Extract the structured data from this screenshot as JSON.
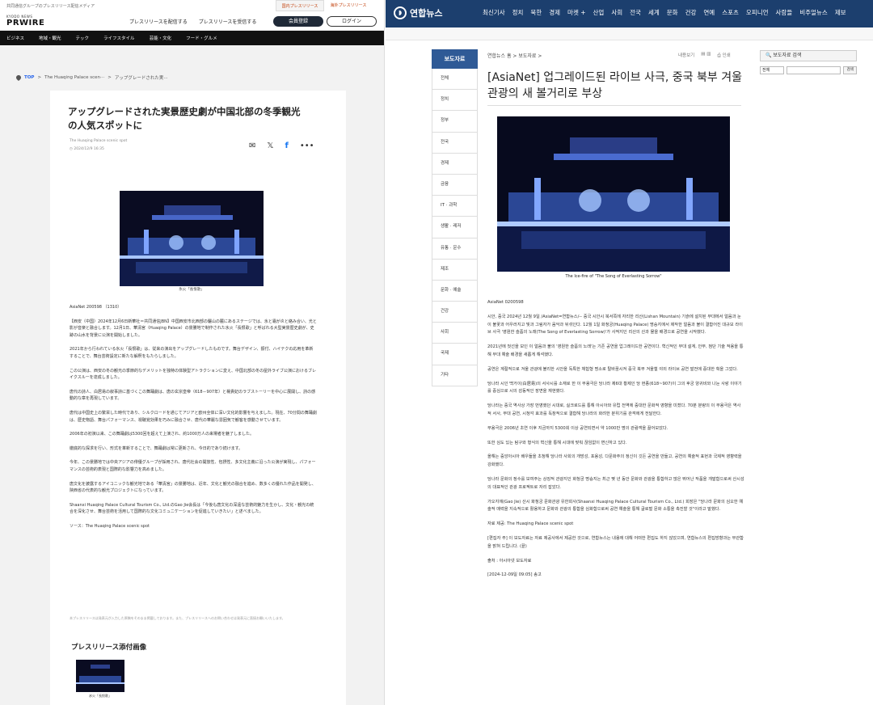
{
  "left": {
    "top_tagline": "共同通信グループのプレスリリース配信メディア",
    "tabs": [
      "国内プレスリリース",
      "海外プレスリリース"
    ],
    "logo_small": "KYODO NEWS",
    "logo_big": "PRWIRE",
    "header_links": [
      "プレスリリースを配信する",
      "プレスリリースを受信する"
    ],
    "register_btn": "会員登録",
    "login_btn": "ログイン",
    "nav": [
      "ビジネス",
      "地域・観光",
      "テック",
      "ライフスタイル",
      "芸能・文化",
      "フード・グルメ"
    ],
    "breadcrumb": {
      "home": "TOP",
      "sep1": ">",
      "mid": "The Huaqing Palace scen···",
      "sep2": ">",
      "cur": "アップグレードされた実···"
    },
    "title": "アップグレードされた実景歴史劇が中国北部の冬季観光の人気スポットに",
    "source": "The Huaqing Palace scenic spot",
    "date": "2024/12/9 16:35",
    "share": {
      "mail": "✉",
      "x": "𝕏",
      "fb": "f",
      "more": "•••"
    },
    "image_caption": "氷火「長恨歌」",
    "paragraphs": [
      "AsiaNet 200598 （1310）",
      "【西安（中国）2024年12月6日新華社＝共同通信JBN】中国西安市北西部の驪山の麓にあるステージでは、氷と霜が炎と絡み合い、光と影が音楽と融合します。12月1日、華清宮（Huaqing Palace）の景勝地で制作された氷火「長恨歌」と呼ばれる大型実景歴史劇が、史跡の山水を背景に公演を開始しました。",
      "2021年から行われている氷火「長恨歌」は、従来の演出をアップグレードしたものです。舞台デザイン、振付、ハイテクの応用を革新することで、舞台芸術設定に新たな解釈をもたらしました。",
      "この公演は、西安の冬の観光の季節的なデメリットを独特の体験型アトラクションに変え、中国北部の冬の屋外ライブ公演におけるブレイクスルーを達成しました。",
      "唐代の詩人、白居易の叙事詩に基づくこの舞踊劇は、唐の玄宗皇帝（618－907年）と楊貴妃のラブストーリーを中心に展開し、詩の感動的な章を再現しています。",
      "唐代は中国史上の繁栄した時代であり、シルクロードを通じてアジアと欧州全体に深い文化的影響を与えました。現在、70分間の舞踊劇は、歴史物語、舞台パフォーマンス、視聴覚効果を巧みに融合させ、唐代の華麗な雰囲気で観客を感動させています。",
      "2006年の初演以来、この舞踊劇は5300回を超えて上演され、約1000万人の来場者を魅了しました。",
      "徹底的な探求を行い、形式を革新することで、舞踊劇は常に更新され、今日的であり続けます。",
      "今年、この景勝地では中央アジアの俳優グループが採用され、唐代社会の開放性、包摂性、多文化主義に沿った公演が実現し、パフォーマンスの芸術的表現と国際的な影響力を高めました。",
      "唐文化を披露するアイコニックな観光地である「華清宮」の景勝地は、近年、文化と観光の融合を進め、数多くの優れた作品を開発し、陝西省の代表的な観光プロジェクトになっています。",
      "Shaanxi Huaqing Palace Cultural Tourism Co., Ltd.のGao Jie会長は「今後も唐文化の深遠な芸術的魅力を生かし、文化・観光の統合を深化させ、舞台芸術を活用して国際的な文化コミュニケーションを促進していきたい」と述べました。",
      "ソース：The Huaqing Palace scenic spot"
    ],
    "note": "本プレスリリースは発表元が入力した原稿をそのまま掲載しております。また、プレスリリースへのお問い合わせは発表元に直接お願いいたします。",
    "attach_heading": "プレスリリース添付画像",
    "thumb_caption": "氷火「長恨歌」"
  },
  "right": {
    "logo": "연합뉴스",
    "nav": [
      "최신기사",
      "정치",
      "북한",
      "경제",
      "마켓 +",
      "산업",
      "사회",
      "전국",
      "세계",
      "문화",
      "건강",
      "연예",
      "스포츠",
      "오피니언",
      "사람들",
      "비주얼뉴스",
      "제보"
    ],
    "sidebar_title": "보도자료",
    "sidebar": [
      "전체",
      "정치",
      "정부",
      "전국",
      "경제",
      "금융",
      "IT · 과학",
      "생활 · 레저",
      "유통 · 운수",
      "제조",
      "문화 · 예술",
      "건강",
      "사회",
      "국제",
      "기타"
    ],
    "breadcrumb": "연합뉴스 홈 > 보도자료 >",
    "tools": {
      "listen": "내용보기",
      "print": "인쇄"
    },
    "title": "[AsiaNet] 업그레이드된 라이브 사극, 중국 북부 겨울 관광의 새 볼거리로 부상",
    "image_caption": "The Ice-fire of \"The Song of Everlasting Sorrow\"",
    "paragraphs": [
      "AsiaNet 0200598",
      "시안, 중국 2024년 12월 9일 /AsiaNet=연합뉴스/-- 중국 시안시 북서쪽에 자리한 리산(Lishan Mountain) 기슭에 설치된 무대에서 얼음과 눈이 불꽃과 어우러지고 빛과 그림자가 음악과 뒤섞인다. 12월 1일 화청궁(Huaqing Palace) 명승지에서 제작한 얼음과 불이 결합어진 대규모 라이브 사극 '영원한 슬픔의 노래(The Song of Everlasting Sorrow)'가 사적지인 리산의 산과 물을 배경으로 공연을 시작했다.",
      "2021년에 첫선을 보인 이 얼음과 불의 '영원한 슬픔의 노래'는 기존 공연을 업그레이드한 공연이다. 혁신적인 무대 설계, 안무, 첨단 기술 적용을 통해 무대 예술 배경을 새롭게 해석했다.",
      "공연은 계절적으로 겨울 관광에 불리한 시안을 독특한 체험형 명소로 탈바꿈시켜 중국 북부 겨울철 야외 라이브 공연 발전에 중대한 획을 그었다.",
      "당나라 시인 백거이(白居易)의 서사시를 소재로 한 이 무용극은 당나라 제6대 황제인 당 현종(618~907)이 그의 후궁 양귀비와 나눈 사랑 이야기를 중심으로 시의 감동적인 장면을 재현했다.",
      "당나라는 중국 역사상 가장 번영했던 시대로, 실크로드를 통해 아시아와 유럽 전역에 중대한 문화적 영향을 미쳤다. 70분 분량의 이 무용극은 역사적 서사, 무대 공연, 시청각 효과를 독창적으로 결합해 당나라의 화려한 분위기를 관객에게 전달한다.",
      "무용극은 2006년 초연 이후 지금까지 5300회 이상 공연되면서 약 1000만 명의 관람객을 끌어모았다.",
      "또한 심도 있는 탐구와 형식의 혁신을 통해 시대에 맞춰 끊임없이 변신하고 있다.",
      "올해는 중앙아시아 배우들을 초청해 당나라 사회의 개방성, 포용성, 다문화주의 정신이 깃든 공연을 만들고, 공연의 예술적 표현과 국제적 영향력을 강화했다.",
      "당나라 문화의 정수를 보여주는 상징적 관광지인 화청궁 명승지는 최근 몇 년 동안 문화와 관광을 통합하고 많은 뛰어난 작품을 개발함으로써 산시성의 대표적인 관광 프로젝트로 자리 잡았다.",
      "가오지에(Gao Jie) 산시 화청궁 문화관광 유한회사(Shaanxi Huaqing Palace Cultural Tourism Co., Ltd.) 회장은 \"당나라 문화의 심오한 예술적 매력을 지속적으로 활용하고 문화와 관광의 통합을 심화함으로써 공연 예술을 통해 글로벌 문화 소통을 촉진할 것\"이라고 말했다.",
      "자료 제공: The Huaqing Palace scenic spot",
      "[편집자 주] 이 보도자료는 자료 제공사에서 제공한 것으로, 연합뉴스는 내용에 대해 어떠한 편집도 하지 않았으며, 연합뉴스의 편집방향과는 무관함을 밝혀 드립니다. (끝)",
      "출처 : 아시아넷 보도자료",
      "[2024-12-09일 09:05] 송고"
    ],
    "search_title": "보도자료 검색",
    "search_select": "전체",
    "search_btn": "검색"
  },
  "colors": {
    "kyodo_nav": "#111111",
    "yonhap_header": "#1c3f6e",
    "sidebar_active": "#2f5a96"
  }
}
